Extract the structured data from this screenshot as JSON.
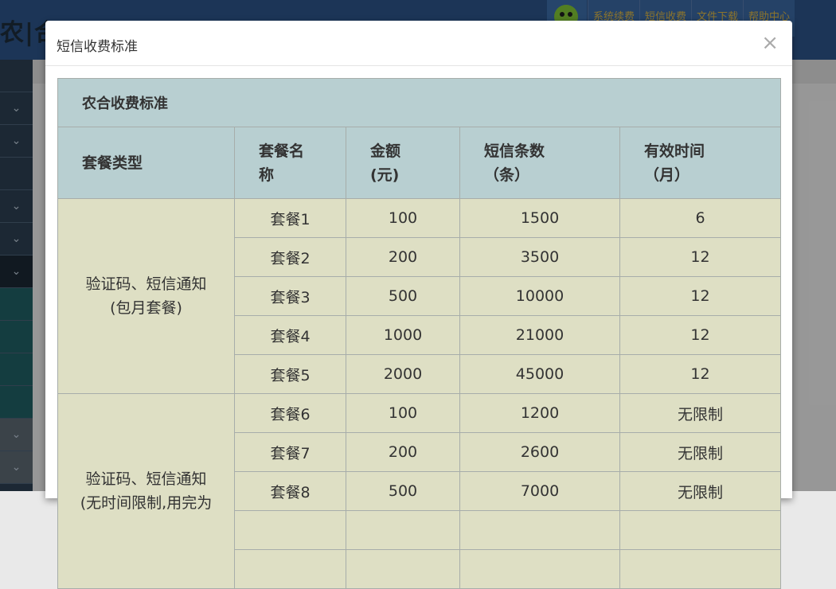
{
  "background": {
    "app_title": "农|合信",
    "nav_items": [
      "系统续费",
      "短信收费",
      "文件下载",
      "帮助中心"
    ],
    "sidebar_chevrons": [
      "⌄",
      "⌄",
      "",
      "⌄",
      "⌄",
      "⌄",
      "",
      "",
      "",
      "",
      "⌄",
      "⌄"
    ]
  },
  "modal": {
    "title": "短信收费标准",
    "close": "×",
    "table": {
      "caption": "农合收费标准",
      "headers": {
        "type": "套餐类型",
        "name_1": "套餐名",
        "name_2": "称",
        "amount_1": "金额",
        "amount_2": "(元)",
        "count_1": "短信条数",
        "count_2": "（条）",
        "duration_1": "有效时间",
        "duration_2": "（月）"
      },
      "groups": [
        {
          "type_line1": "验证码、短信通知",
          "type_line2": "(包月套餐)",
          "rows": [
            {
              "name": "套餐1",
              "amount": "100",
              "count": "1500",
              "duration": "6"
            },
            {
              "name": "套餐2",
              "amount": "200",
              "count": "3500",
              "duration": "12"
            },
            {
              "name": "套餐3",
              "amount": "500",
              "count": "10000",
              "duration": "12"
            },
            {
              "name": "套餐4",
              "amount": "1000",
              "count": "21000",
              "duration": "12"
            },
            {
              "name": "套餐5",
              "amount": "2000",
              "count": "45000",
              "duration": "12"
            }
          ]
        },
        {
          "type_line1": "验证码、短信通知",
          "type_line2": "(无时间限制,用完为",
          "rows": [
            {
              "name": "套餐6",
              "amount": "100",
              "count": "1200",
              "duration": "无限制"
            },
            {
              "name": "套餐7",
              "amount": "200",
              "count": "2600",
              "duration": "无限制"
            },
            {
              "name": "套餐8",
              "amount": "500",
              "count": "7000",
              "duration": "无限制"
            }
          ]
        }
      ]
    }
  }
}
